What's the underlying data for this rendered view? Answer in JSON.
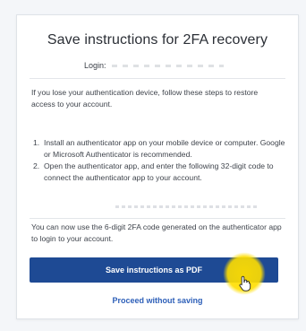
{
  "dialog": {
    "title": "Save instructions for 2FA recovery",
    "login_label": "Login:",
    "intro": "If you lose your authentication device, follow these steps to restore access to your account.",
    "steps": [
      {
        "num": "1.",
        "text": "Install an authenticator app on your mobile device or computer. Google or Microsoft Authenticator is recommended."
      },
      {
        "num": "2.",
        "text": "Open the authenticator app, and enter the following 32-digit code to connect the authenticator app to your account."
      }
    ],
    "outro": "You can now use the 6-digit 2FA code generated on the authenticator app to login to your account.",
    "primary_button": "Save instructions as PDF",
    "secondary_link": "Proceed without saving"
  },
  "colors": {
    "primary": "#1e4a94",
    "link": "#2d5fb8",
    "highlight": "#ffde00"
  },
  "icons": {
    "cursor": "hand-pointer-icon"
  }
}
